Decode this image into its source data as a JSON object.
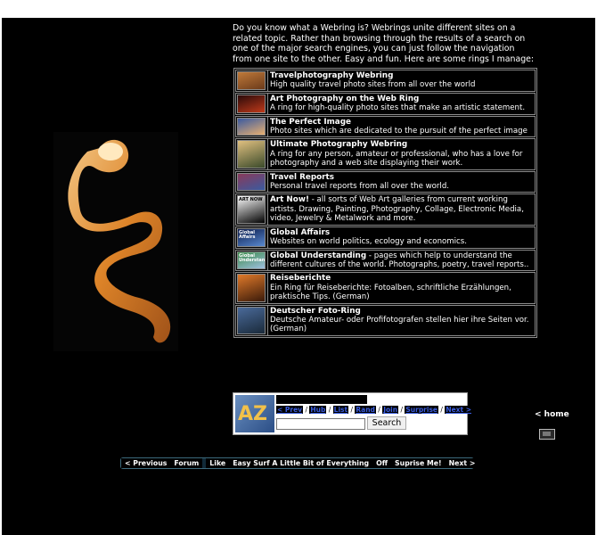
{
  "intro": "Do you know what a Webring is? Webrings unite different sites on a related topic. Rather than browsing through the results of a search on one of the major search engines, you can just follow the navigation from one site to the other. Easy and fun. Here are some rings I manage:",
  "rings": [
    {
      "title": "Travelphotography Webring",
      "desc": "High quality travel photo sites from all over the world",
      "colors": [
        "#c07a3a",
        "#6b3a1a"
      ]
    },
    {
      "title": "Art Photography on the Web Ring",
      "desc": "A ring for high-quality photo sites that make an artistic statement.",
      "colors": [
        "#2a0a0a",
        "#c03a1a"
      ]
    },
    {
      "title": "The Perfect Image",
      "desc": "Photo sites which are dedicated to the pursuit of the perfect image",
      "colors": [
        "#3a5aa0",
        "#e8b070"
      ]
    },
    {
      "title": "Ultimate Photography Webring",
      "desc": "A ring for any person, amateur or professional, who has a love for photography and a web site displaying their work.",
      "colors": [
        "#e0c080",
        "#3a4a2a"
      ]
    },
    {
      "title": "Travel Reports",
      "desc": "Personal travel reports from all over the world.",
      "colors": [
        "#8a3a5a",
        "#3a5aa0"
      ]
    },
    {
      "title": "Art Now!",
      "desc": " - all sorts of Web Art galleries from current working artists. Drawing, Painting, Photography, Collage, Electronic Media, video, Jewelry & Metalwork and more.",
      "colors": [
        "#ffffff",
        "#000000"
      ],
      "thumb_text": "ART NOW"
    },
    {
      "title": "Global Affairs",
      "desc": "Websites on world politics, ecology and economics.",
      "colors": [
        "#0a1a4a",
        "#5a8ad0"
      ],
      "thumb_text": "Global Affairs"
    },
    {
      "title": "Global Understanding",
      "desc": " - pages which help to understand the different cultures of the world. Photographs, poetry, travel reports..",
      "colors": [
        "#3a8a4a",
        "#a0c0e0"
      ],
      "thumb_text": "Global Understanding"
    },
    {
      "title": "Reiseberichte",
      "desc": "Ein Ring für Reiseberichte: Fotoalben, schriftliche Erzählungen, praktische Tips. (German)",
      "colors": [
        "#e07a2a",
        "#3a1a0a"
      ]
    },
    {
      "title": "Deutscher Foto-Ring",
      "desc": "Deutsche Amateur- oder Profifotografen stellen hier ihre Seiten vor. (German)",
      "colors": [
        "#4a6a9a",
        "#1a2a3a"
      ]
    }
  ],
  "az": {
    "logo": "AZ",
    "links": [
      "< Prev",
      "Hub",
      "List",
      "Rand",
      "Join",
      "Surprise",
      "Next >"
    ],
    "search_button": "Search"
  },
  "home": {
    "label": "< home"
  },
  "ringnav": {
    "previous": "< Previous",
    "forum": "Forum",
    "like": "Like",
    "title": "Easy Surf A Little Bit of Everything",
    "off": "Off",
    "surprise": "Suprise Me!",
    "next": "Next >"
  }
}
